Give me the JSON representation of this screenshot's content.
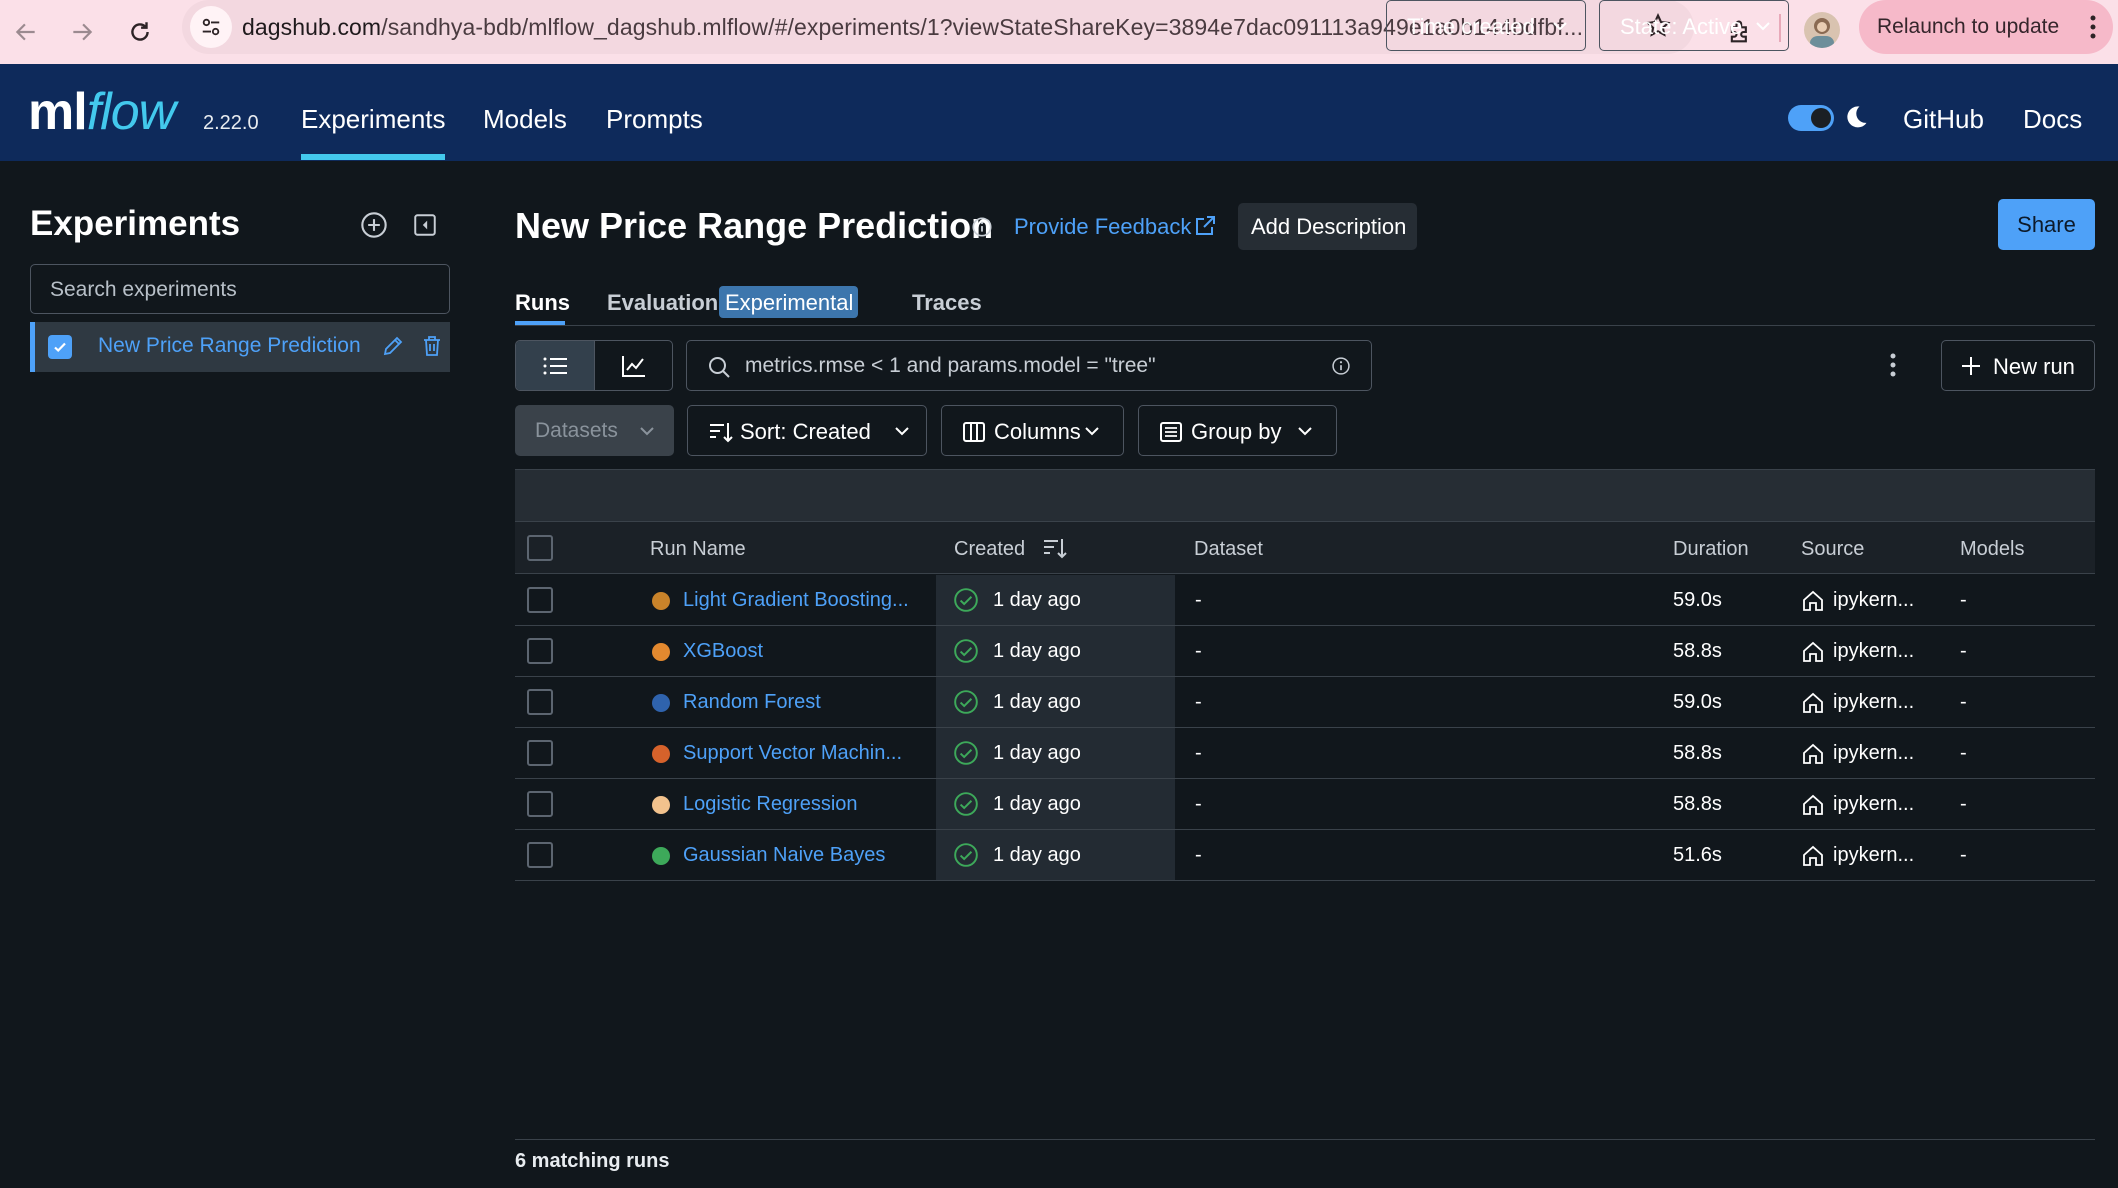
{
  "browser": {
    "url_host": "dagshub.com",
    "url_rest": "/sandhya-bdb/mlflow_dagshub.mlflow/#/experiments/1?viewStateShareKey=3894e7dac091113a949e1a0b144bdfbf...",
    "relaunch_label": "Relaunch to update"
  },
  "nav": {
    "logo_ml": "ml",
    "logo_flow": "flow",
    "version": "2.22.0",
    "links": [
      "Experiments",
      "Models",
      "Prompts"
    ],
    "active": "Experiments",
    "github": "GitHub",
    "docs": "Docs"
  },
  "sidebar": {
    "title": "Experiments",
    "search_placeholder": "Search experiments",
    "items": [
      {
        "label": "New Price Range Prediction",
        "checked": true
      }
    ]
  },
  "header": {
    "title": "New Price Range Prediction",
    "feedback_label": "Provide Feedback",
    "add_description_label": "Add Description",
    "share_label": "Share"
  },
  "tabs": {
    "runs": "Runs",
    "evaluation": "Evaluation",
    "evaluation_badge": "Experimental",
    "traces": "Traces"
  },
  "toolbar": {
    "search_value": "metrics.rmse < 1 and params.model = \"tree\"",
    "time_created": "Time created",
    "state": "State: Active",
    "new_run": "New run",
    "datasets": "Datasets",
    "sort": "Sort: Created",
    "columns": "Columns",
    "group_by": "Group by"
  },
  "table": {
    "columns": [
      "Run Name",
      "Created",
      "Dataset",
      "Duration",
      "Source",
      "Models"
    ],
    "rows": [
      {
        "name": "Light Gradient Boosting...",
        "color": "#c9832a",
        "created": "1 day ago",
        "dataset": "-",
        "duration": "59.0s",
        "source": "ipykern...",
        "models": "-"
      },
      {
        "name": "XGBoost",
        "color": "#e3892f",
        "created": "1 day ago",
        "dataset": "-",
        "duration": "58.8s",
        "source": "ipykern...",
        "models": "-"
      },
      {
        "name": "Random Forest",
        "color": "#2f63ad",
        "created": "1 day ago",
        "dataset": "-",
        "duration": "59.0s",
        "source": "ipykern...",
        "models": "-"
      },
      {
        "name": "Support Vector Machin...",
        "color": "#d6622b",
        "created": "1 day ago",
        "dataset": "-",
        "duration": "58.8s",
        "source": "ipykern...",
        "models": "-"
      },
      {
        "name": "Logistic Regression",
        "color": "#f2c28d",
        "created": "1 day ago",
        "dataset": "-",
        "duration": "58.8s",
        "source": "ipykern...",
        "models": "-"
      },
      {
        "name": "Gaussian Naive Bayes",
        "color": "#3da95a",
        "created": "1 day ago",
        "dataset": "-",
        "duration": "51.6s",
        "source": "ipykern...",
        "models": "-"
      }
    ]
  },
  "footer": {
    "matching_runs": "6 matching runs"
  },
  "colors": {
    "accent": "#4ea1f8",
    "nav_bg": "#0e2a5b",
    "logo_flow": "#43c9ed",
    "page_bg": "#11171c",
    "success": "#3da95a"
  }
}
